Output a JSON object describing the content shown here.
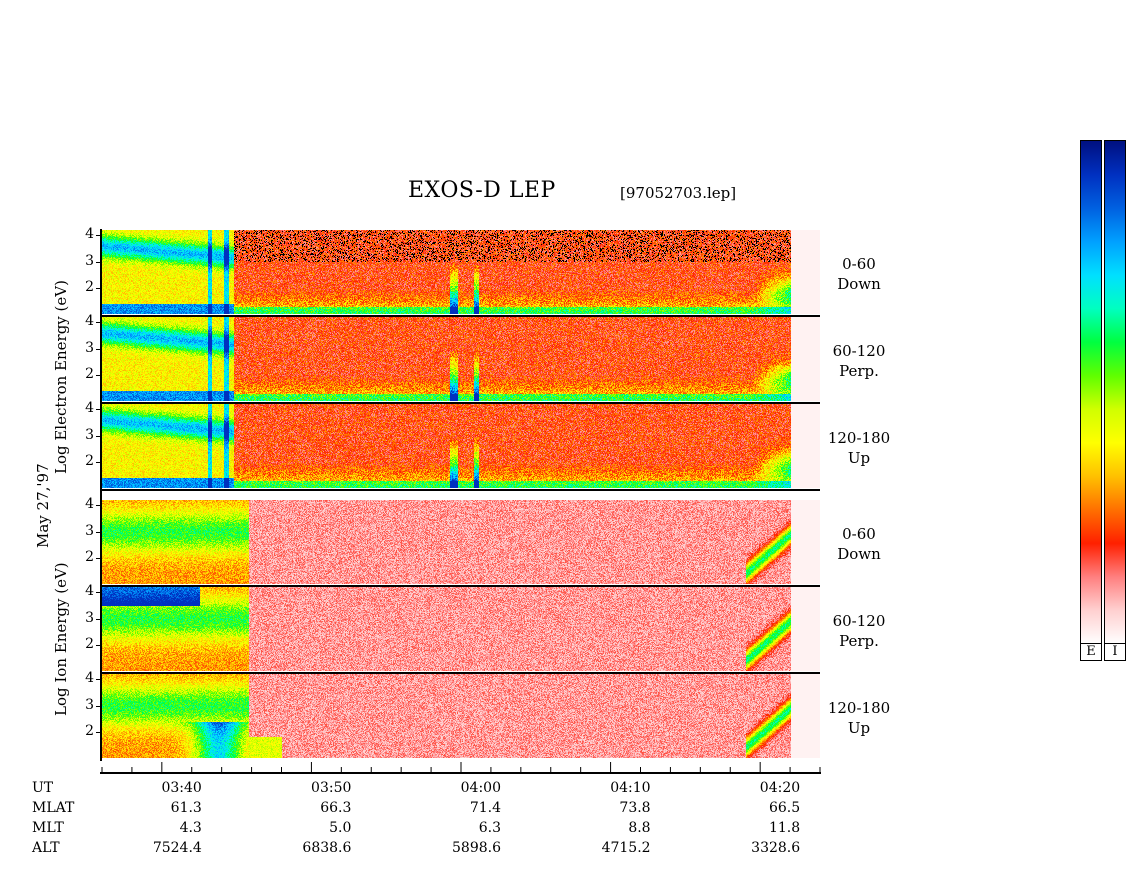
{
  "title": "EXOS-D LEP",
  "file_label": "[97052703.lep]",
  "date_label": "May 27,'97",
  "electron_axis_label": "Log  Electron  Energy (eV)",
  "ion_axis_label": "Log  Ion  Energy (eV)",
  "y_ticks": [
    "4",
    "3",
    "2"
  ],
  "panels": [
    {
      "id": "e-down",
      "species": "electron",
      "pitch": "0-60",
      "dir": "Down"
    },
    {
      "id": "e-perp",
      "species": "electron",
      "pitch": "60-120",
      "dir": "Perp."
    },
    {
      "id": "e-up",
      "species": "electron",
      "pitch": "120-180",
      "dir": "Up"
    },
    {
      "id": "i-down",
      "species": "ion",
      "pitch": "0-60",
      "dir": "Down"
    },
    {
      "id": "i-perp",
      "species": "ion",
      "pitch": "60-120",
      "dir": "Perp."
    },
    {
      "id": "i-up",
      "species": "ion",
      "pitch": "120-180",
      "dir": "Up"
    }
  ],
  "colorbars": {
    "electron_label": "E",
    "ion_label": "I",
    "palette": [
      "#001080",
      "#0030c0",
      "#0060e0",
      "#00a0ff",
      "#00e0ff",
      "#00ffc0",
      "#00ff40",
      "#60ff00",
      "#d0ff00",
      "#ffff00",
      "#ffc000",
      "#ff7000",
      "#ff2000",
      "#ff8080",
      "#ffd0d0",
      "#ffffff"
    ]
  },
  "chart_data": {
    "type": "heatmap",
    "title": "EXOS-D LEP",
    "ylabel": "Log Energy (eV)",
    "ylim": [
      1,
      4.2
    ],
    "y_ticks": [
      2,
      3,
      4
    ],
    "ephemeris_labels": [
      "UT",
      "MLAT",
      "MLT",
      "ALT"
    ],
    "ephemeris": [
      {
        "UT": "03:40",
        "MLAT": "61.3",
        "MLT": "4.3",
        "ALT": "7524.4"
      },
      {
        "UT": "03:50",
        "MLAT": "66.3",
        "MLT": "5.0",
        "ALT": "6838.6"
      },
      {
        "UT": "04:00",
        "MLAT": "71.4",
        "MLT": "6.3",
        "ALT": "5898.6"
      },
      {
        "UT": "04:10",
        "MLAT": "73.8",
        "MLT": "8.8",
        "ALT": "4715.2"
      },
      {
        "UT": "04:20",
        "MLAT": "66.5",
        "MLT": "11.8",
        "ALT": "3328.6"
      }
    ],
    "time_range_min": [
      -4,
      44
    ],
    "data_end_min": 42
  }
}
